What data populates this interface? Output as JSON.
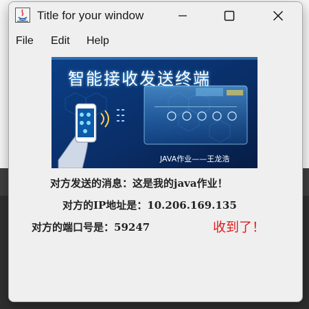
{
  "window": {
    "title": "Title for your window"
  },
  "menu": {
    "items": [
      "File",
      "Edit",
      "Help"
    ]
  },
  "banner": {
    "heading": "智能接收发送终端",
    "caption": "JAVA作业——王龙浩"
  },
  "info": {
    "message_label": "对方发送的消息：",
    "message_value": "这是我的java作业！",
    "ip_label": "对方的IP地址是：",
    "ip_value": "10.206.169.135",
    "port_label": "对方的端口号是：",
    "port_value": "59247"
  },
  "status": {
    "received": "收到了！"
  },
  "colors": {
    "accent_red": "#e21b1b",
    "banner_blue": "#0a2f6b"
  }
}
